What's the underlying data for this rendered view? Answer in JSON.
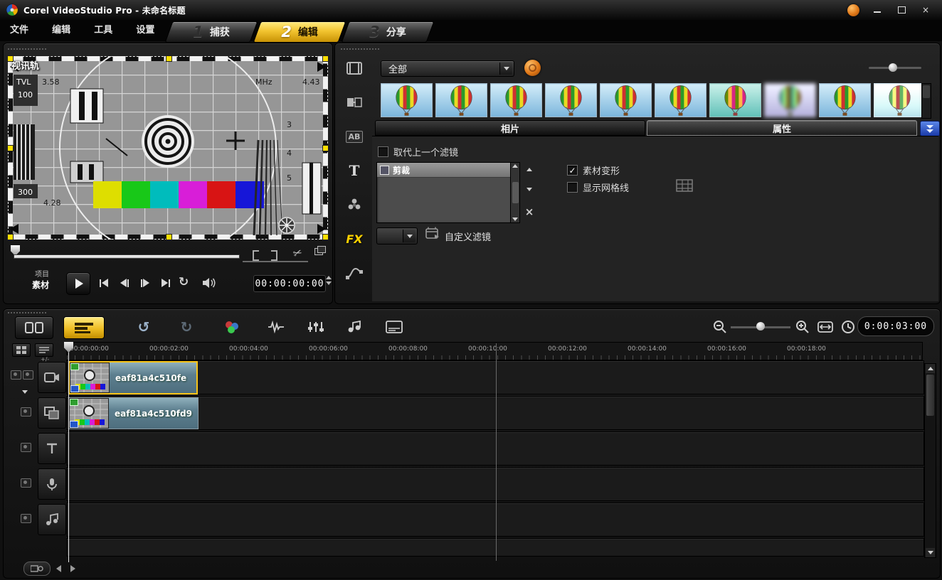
{
  "titlebar": {
    "title": "Corel VideoStudio Pro - 未命名标题"
  },
  "icons": {
    "close": "×",
    "check": "✓",
    "undo": "↺",
    "redo": "↻",
    "repeat": "↻",
    "scissors": "✂",
    "delete_x": "×"
  },
  "menubar": {
    "items": [
      "文件",
      "编辑",
      "工具",
      "设置"
    ]
  },
  "steps": [
    {
      "num": "1",
      "label": "捕获"
    },
    {
      "num": "2",
      "label": "编辑"
    },
    {
      "num": "3",
      "label": "分享"
    }
  ],
  "preview": {
    "overlay_label": "视讯轨",
    "mode_project": "项目",
    "mode_clip": "素材",
    "timecode": "00:00:00:00",
    "pattern": {
      "tvl": "TVL",
      "n100": "100",
      "n300": "300",
      "f1": "3.58",
      "f2": "4.43",
      "f3": "4.28",
      "mhz": "MHz",
      "r3": "3",
      "r4": "4",
      "r5": "5"
    }
  },
  "library": {
    "category": "全部",
    "tab_photo": "相片",
    "tab_attr": "属性",
    "rail_ab": "AB",
    "rail_t": "T",
    "rail_fx": "FX"
  },
  "attributes": {
    "replace_filter": "取代上一个滤镜",
    "filters": [
      {
        "name": "剪裁"
      }
    ],
    "deform": "素材变形",
    "grid": "显示网格线",
    "customize": "自定义滤镜"
  },
  "timeline": {
    "timecode": "0:00:03:00",
    "plus_minus": "+/-",
    "ruler": [
      "00:00:00:00",
      "00:00:02:00",
      "00:00:04:00",
      "00:00:06:00",
      "00:00:08:00",
      "00:00:10:00",
      "00:00:12:00",
      "00:00:14:00",
      "00:00:16:00",
      "00:00:18:00"
    ],
    "tracks": [
      {
        "clip": "eaf81a4c510fe"
      },
      {
        "clip": "eaf81a4c510fd9"
      }
    ]
  },
  "colors": {
    "accent_yellow": "#f2c430",
    "clip_teal": "#5d7f8f",
    "selection_yellow": "#f6c318",
    "expand_blue": "#2a52c8"
  }
}
